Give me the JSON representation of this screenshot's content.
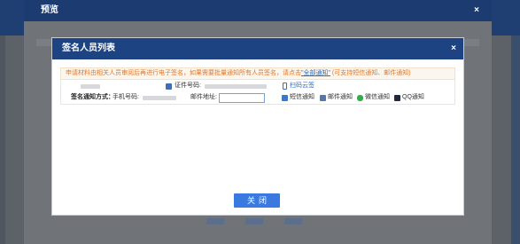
{
  "outer": {
    "title": "预览",
    "close": "×"
  },
  "dialog": {
    "title": "签名人员列表",
    "close": "×"
  },
  "notice": {
    "text_before": "申请材料由相关人员审阅后再进行电子签名，如果需要批量通知所有人员签名，请点击",
    "link": "\"全部通知\"",
    "text_after": " (可支持短信通知、邮件通知)"
  },
  "signer": {
    "id_label": "证件号码:",
    "scan_label": "扫码云签",
    "notify_label": "签名通知方式：",
    "phone_label": "手机号码:",
    "email_label": "邮件地址:",
    "email_value": "",
    "options": [
      "短信通知",
      "邮件通知",
      "微信通知",
      "QQ通知"
    ]
  },
  "footer": {
    "close_button": "关闭"
  }
}
